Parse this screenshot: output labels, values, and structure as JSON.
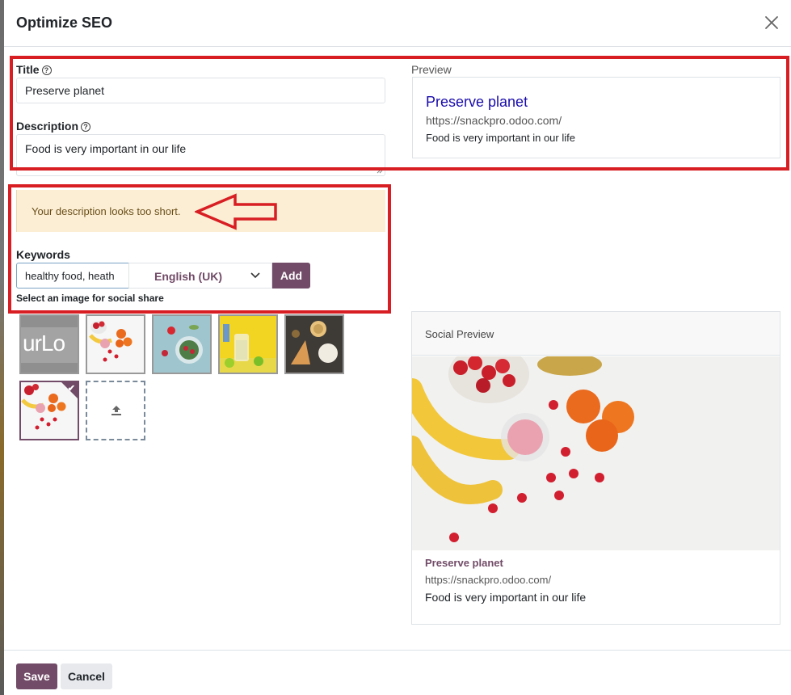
{
  "dialog": {
    "title": "Optimize SEO"
  },
  "form": {
    "title_label": "Title",
    "title_value": "Preserve planet",
    "description_label": "Description",
    "description_value": "Food is very important in our life",
    "warning": "Your description looks too short.",
    "keywords_label": "Keywords",
    "keywords_value": "healthy food, heath",
    "language_selected": "English (UK)",
    "add_label": "Add",
    "image_share_label": "Select an image for social share",
    "logo_thumb_text": "urLo"
  },
  "preview": {
    "label": "Preview",
    "title": "Preserve planet",
    "url": "https://snackpro.odoo.com/",
    "description": "Food is very important in our life"
  },
  "social_preview": {
    "header": "Social Preview",
    "title": "Preserve planet",
    "url": "https://snackpro.odoo.com/",
    "description": "Food is very important in our life"
  },
  "footer": {
    "save_label": "Save",
    "cancel_label": "Cancel"
  },
  "colors": {
    "primary": "#714b67",
    "annotation_red": "#d81e23",
    "preview_link": "#1a0dab",
    "warning_bg": "#fbeed4"
  }
}
